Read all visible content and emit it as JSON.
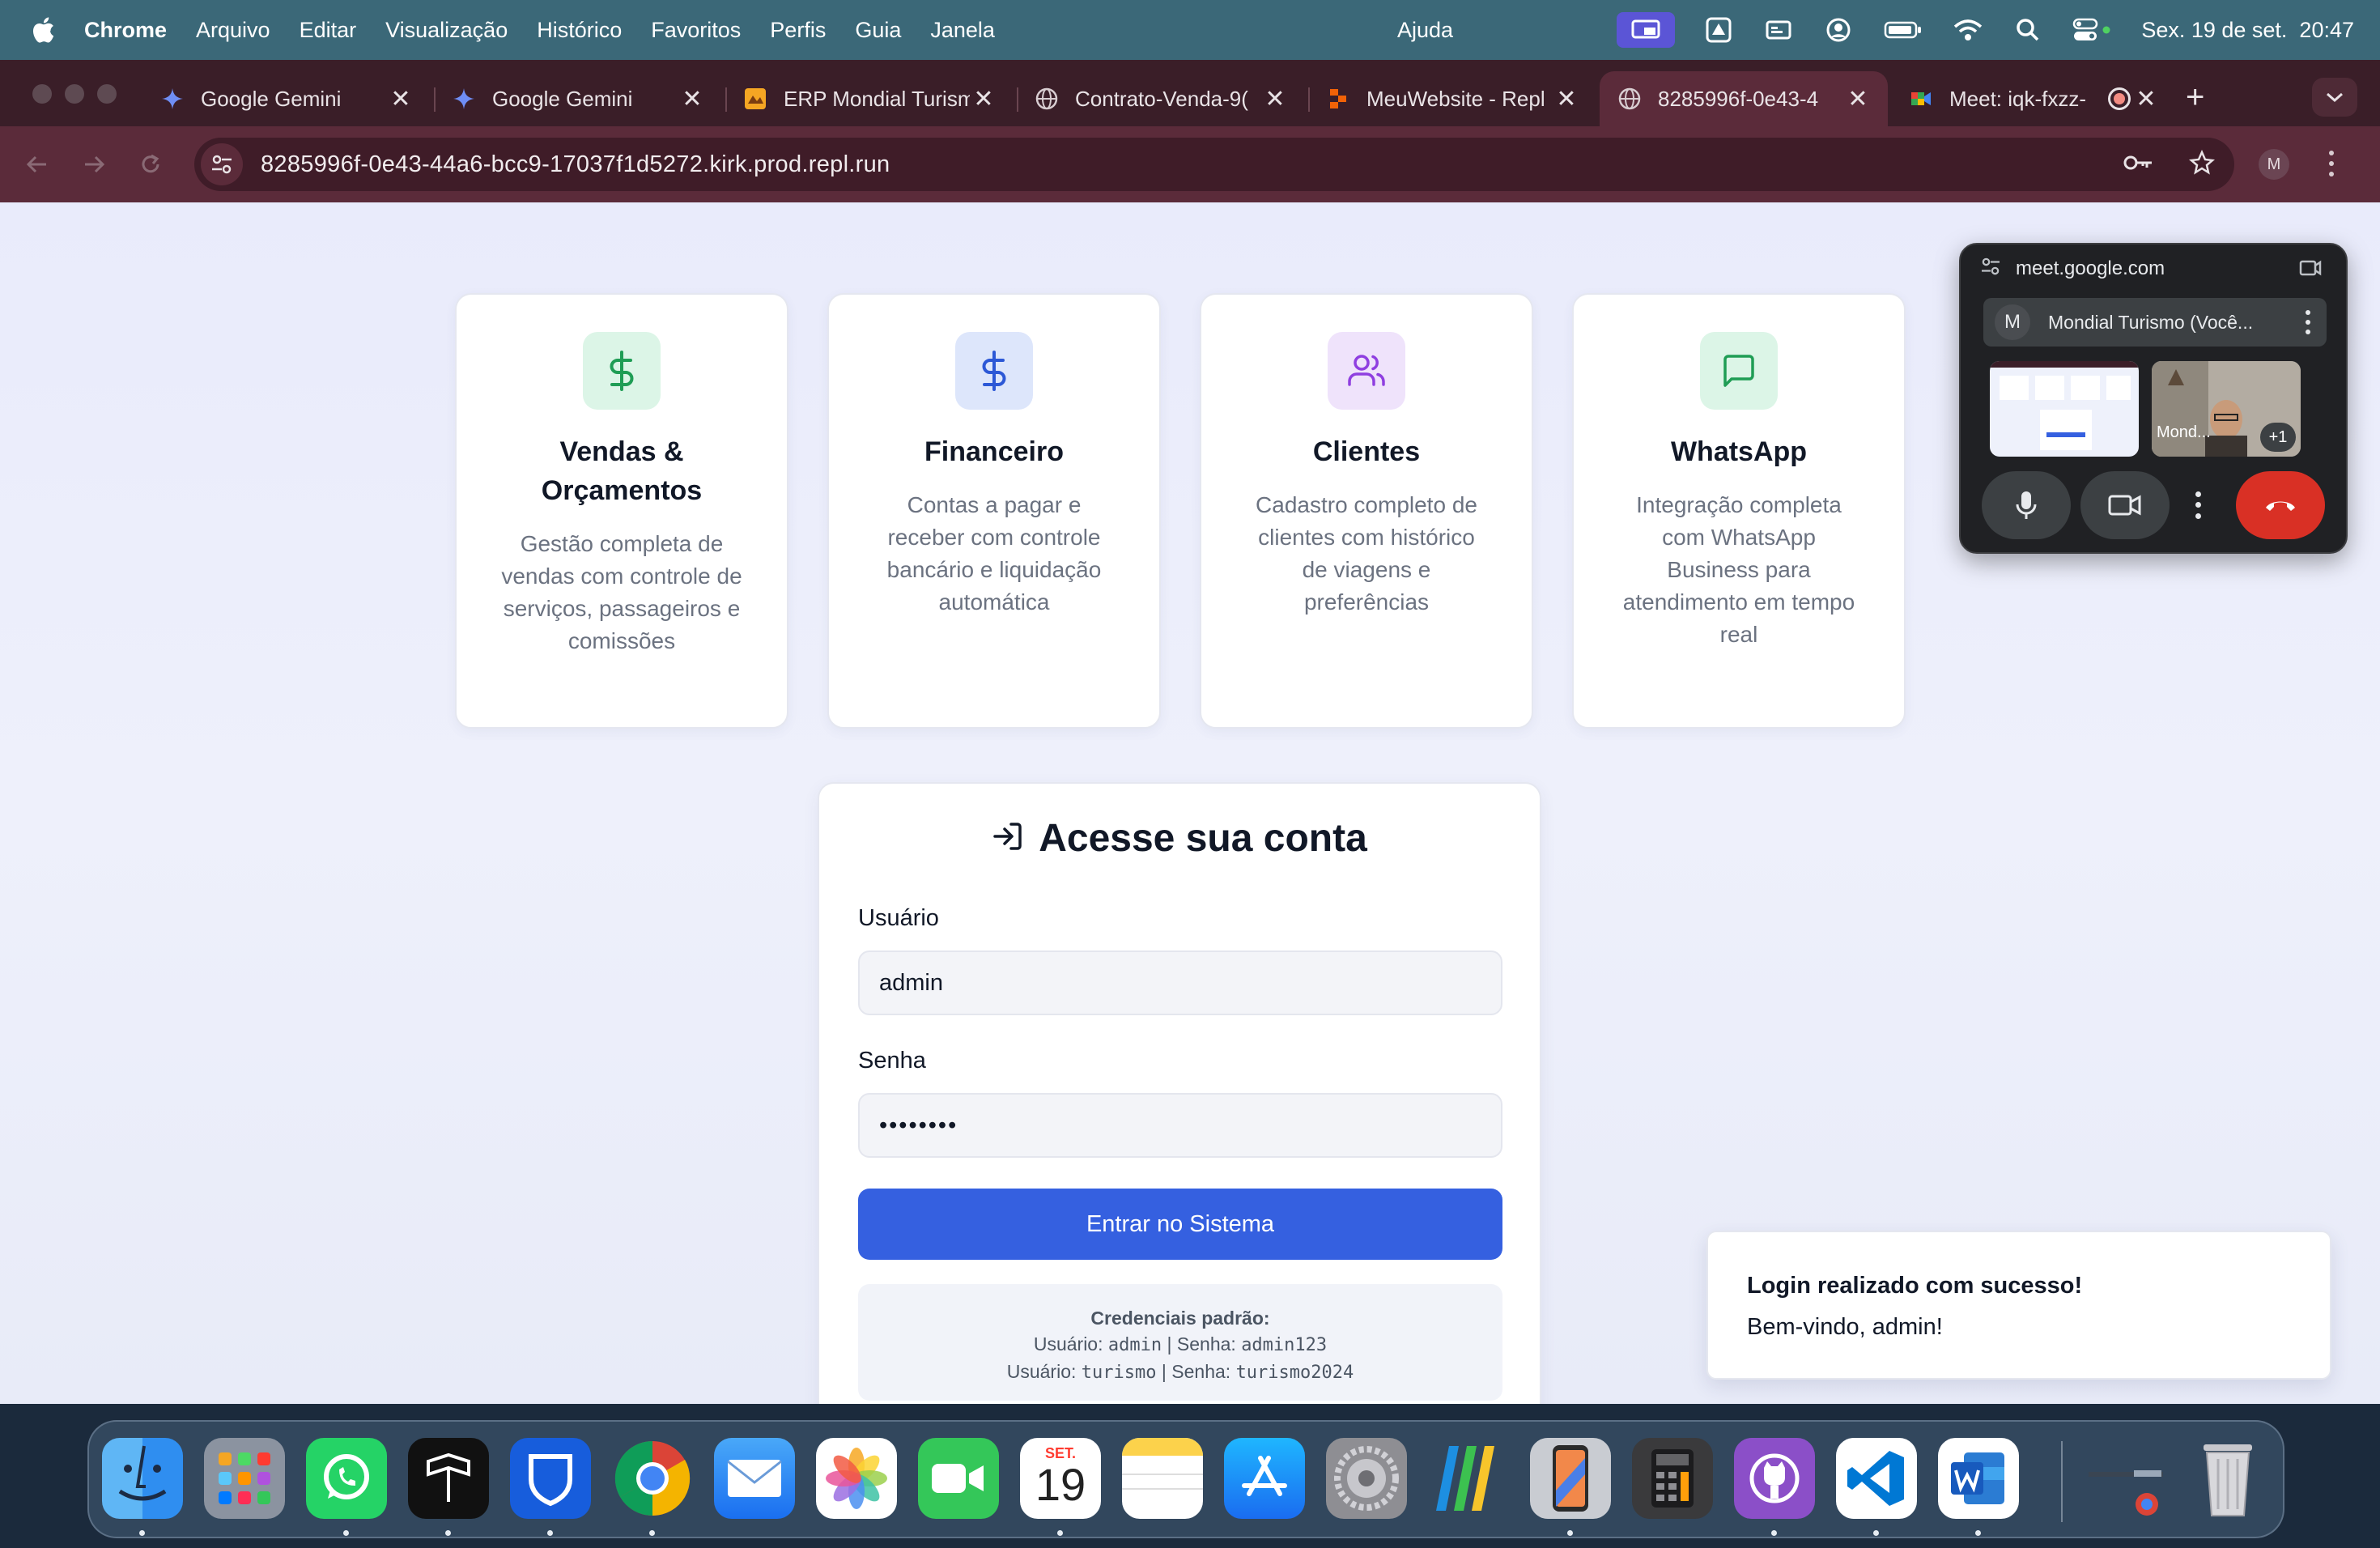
{
  "menubar": {
    "app_name": "Chrome",
    "items": [
      "Arquivo",
      "Editar",
      "Visualização",
      "Histórico",
      "Favoritos",
      "Perfis",
      "Guia",
      "Janela"
    ],
    "center_item": "Ajuda",
    "datetime": "Sex. 19 de set.  20:47"
  },
  "tabs": [
    {
      "label": "Google Gemini",
      "icon": "gemini-icon"
    },
    {
      "label": "Google Gemini",
      "icon": "gemini-icon"
    },
    {
      "label": "ERP Mondial Turism",
      "icon": "erp-icon"
    },
    {
      "label": "Contrato-Venda-9(",
      "icon": "globe-icon"
    },
    {
      "label": "MeuWebsite - Repl",
      "icon": "replit-icon"
    },
    {
      "label": "8285996f-0e43-4",
      "icon": "globe-icon",
      "active": true
    },
    {
      "label": "Meet: iqk-fxzz-",
      "icon": "meet-icon"
    }
  ],
  "toolbar": {
    "url": "8285996f-0e43-44a6-bcc9-17037f1d5272.kirk.prod.repl.run",
    "profile_initial": "M"
  },
  "features": [
    {
      "title": "Vendas & Orçamentos",
      "desc": "Gestão completa de vendas com controle de serviços, passageiros e comissões",
      "icon": "dollar-icon",
      "bg": "#dcf5e7",
      "color": "#1f9d55"
    },
    {
      "title": "Financeiro",
      "desc": "Contas a pagar e receber com controle bancário e liquidação automática",
      "icon": "dollar-icon",
      "bg": "#dde6fb",
      "color": "#2c58d6"
    },
    {
      "title": "Clientes",
      "desc": "Cadastro completo de clientes com histórico de viagens e preferências",
      "icon": "users-icon",
      "bg": "#efe3fb",
      "color": "#8f3fe0"
    },
    {
      "title": "WhatsApp",
      "desc": "Integração completa com WhatsApp Business para atendimento em tempo real",
      "icon": "chat-icon",
      "bg": "#dcf5e7",
      "color": "#1f9d55"
    }
  ],
  "login": {
    "title": "Acesse sua conta",
    "user_label": "Usuário",
    "user_value": "admin",
    "pass_label": "Senha",
    "pass_value": "••••••••",
    "submit": "Entrar no Sistema",
    "creds_title": "Credenciais padrão:",
    "creds": [
      {
        "user_label": "Usuário:",
        "user": "admin",
        "pass_label": "Senha:",
        "pass": "admin123"
      },
      {
        "user_label": "Usuário:",
        "user": "turismo",
        "pass_label": "Senha:",
        "pass": "turismo2024"
      }
    ]
  },
  "toast": {
    "title": "Login realizado com sucesso!",
    "message": "Bem-vindo, admin!"
  },
  "meet": {
    "domain": "meet.google.com",
    "participant_initial": "M",
    "participant": "Mondial Turismo (Você...",
    "tile_label": "Mond...",
    "extra_count": "+1"
  },
  "dock": {
    "calendar_month": "SET.",
    "calendar_day": "19",
    "apps": [
      "finder",
      "launchpad",
      "whatsapp",
      "typora",
      "bitwarden",
      "chrome",
      "mail",
      "photos",
      "facetime",
      "calendar",
      "notes",
      "app-store",
      "system-settings",
      "ticker",
      "simulator",
      "calculator",
      "github-desktop",
      "vscode",
      "word"
    ]
  }
}
